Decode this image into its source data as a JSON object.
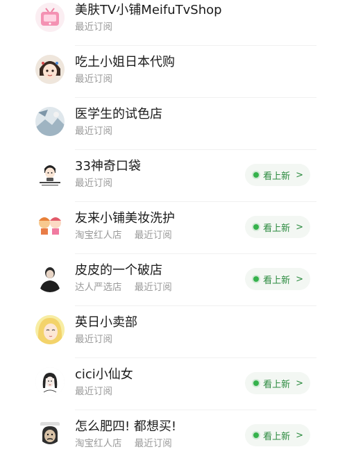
{
  "shops": [
    {
      "name": "美肤TV小铺MeifuTvShop",
      "tag": "",
      "status": "最近订阅",
      "has_new": false,
      "avatar_icon": "pink-tv-icon"
    },
    {
      "name": "吃土小姐日本代购",
      "tag": "",
      "status": "最近订阅",
      "has_new": false,
      "avatar_icon": "cartoon-girl-icon"
    },
    {
      "name": "医学生的试色店",
      "tag": "",
      "status": "最近订阅",
      "has_new": false,
      "avatar_icon": "photo-avatar-icon"
    },
    {
      "name": "33神奇口袋",
      "tag": "",
      "status": "最近订阅",
      "has_new": true,
      "avatar_icon": "chibi-logo-icon"
    },
    {
      "name": "友来小铺美妆洗护",
      "tag": "淘宝红人店",
      "status": "最近订阅",
      "has_new": true,
      "avatar_icon": "cartoon-pair-icon"
    },
    {
      "name": "皮皮的一个破店",
      "tag": "达人严选店",
      "status": "最近订阅",
      "has_new": true,
      "avatar_icon": "man-silhouette-icon"
    },
    {
      "name": "英日小卖部",
      "tag": "",
      "status": "最近订阅",
      "has_new": false,
      "avatar_icon": "blonde-girl-icon"
    },
    {
      "name": "cici小仙女",
      "tag": "",
      "status": "最近订阅",
      "has_new": true,
      "avatar_icon": "sketch-girl-icon"
    },
    {
      "name": "怎么肥四! 都想买!",
      "tag": "淘宝红人店",
      "status": "最近订阅",
      "has_new": true,
      "avatar_icon": "meme-face-icon"
    }
  ],
  "new_button_label": "看上新",
  "new_button_chevron": ">",
  "colors": {
    "accent_green": "#2a8a3e",
    "dot_green": "#35b24c",
    "pill_bg": "#f3f7f3",
    "meta_gray": "#9a9a9a"
  }
}
